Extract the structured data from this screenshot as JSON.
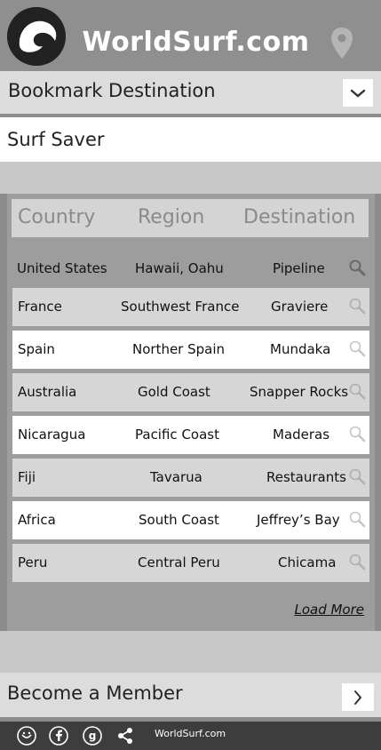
{
  "header": {
    "title": "WorldSurf.com",
    "logo_icon": "wave-logo-icon",
    "location_icon": "location-pin-icon"
  },
  "bookmark": {
    "label": "Bookmark Destination",
    "dropdown_icon": "chevron-down-icon"
  },
  "subtitle": "Surf Saver",
  "table": {
    "columns": [
      "Country",
      "Region",
      "Destination"
    ],
    "rows": [
      {
        "country": "United States",
        "region": "Hawaii, Oahu",
        "destination": "Pipeline"
      },
      {
        "country": "France",
        "region": "Southwest France",
        "destination": "Graviere"
      },
      {
        "country": "Spain",
        "region": "Norther Spain",
        "destination": "Mundaka"
      },
      {
        "country": "Australia",
        "region": "Gold Coast",
        "destination": "Snapper Rocks"
      },
      {
        "country": "Nicaragua",
        "region": "Pacific Coast",
        "destination": "Maderas"
      },
      {
        "country": "Fiji",
        "region": "Tavarua",
        "destination": "Restaurants"
      },
      {
        "country": "Africa",
        "region": "South Coast",
        "destination": "Jeffrey’s Bay"
      },
      {
        "country": "Peru",
        "region": "Central Peru",
        "destination": "Chicama"
      }
    ],
    "load_more": "Load More"
  },
  "member": {
    "label": "Become a Member",
    "arrow_icon": "chevron-right-icon"
  },
  "footer": {
    "text": "WorldSurf.com",
    "icons": [
      "smiley-icon",
      "facebook-icon",
      "google-plus-icon",
      "share-icon"
    ]
  },
  "colors": {
    "header_bg": "#8f8f8f",
    "panel_bg": "#9d9d9d",
    "footer_bg": "#3d3d3d"
  }
}
